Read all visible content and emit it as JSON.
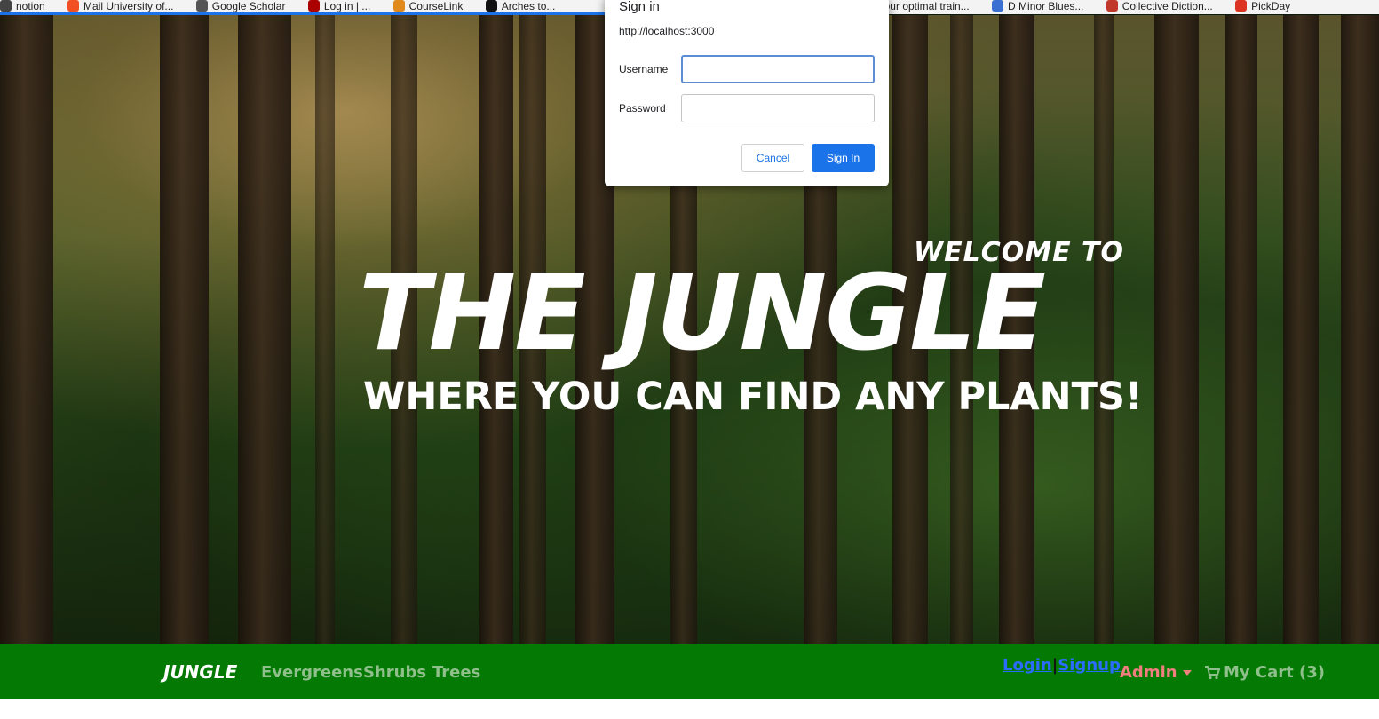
{
  "bookmarks": [
    {
      "label": "notion",
      "color": "#444"
    },
    {
      "label": "Mail University of...",
      "color": "#f25022"
    },
    {
      "label": "Google Scholar",
      "color": "#555"
    },
    {
      "label": "Log in | ...",
      "color": "#a00"
    },
    {
      "label": "CourseLink",
      "color": "#e08a1e"
    },
    {
      "label": "Arches to...",
      "color": "#111"
    },
    {
      "label": "Your optimal train...",
      "color": "#111"
    },
    {
      "label": "D Minor Blues...",
      "color": "#3b6fd1"
    },
    {
      "label": "Collective Diction...",
      "color": "#c0392b"
    },
    {
      "label": "PickDay",
      "color": "#d32"
    }
  ],
  "hero": {
    "welcome": "WELCOME TO",
    "title": "THE JUNGLE",
    "tagline": "WHERE YOU CAN FIND ANY PLANTS!"
  },
  "navbar": {
    "brand": "JUNGLE",
    "links": [
      "Evergreens",
      "Shrubs",
      "Trees"
    ],
    "login": "Login",
    "separator": "|",
    "signup": "Signup",
    "admin": "Admin",
    "cart": "My Cart (3)",
    "cart_icon": "shopping-cart-icon"
  },
  "dialog": {
    "title": "Sign in",
    "origin": "http://localhost:3000",
    "username_label": "Username",
    "username_value": "",
    "password_label": "Password",
    "password_value": "",
    "cancel_label": "Cancel",
    "signin_label": "Sign In"
  },
  "colors": {
    "navbar_bg": "#047a04",
    "nav_link": "#8fbf8a",
    "auth_link": "#2b6cff",
    "admin": "#f08080",
    "primary_button": "#1a73e8"
  }
}
